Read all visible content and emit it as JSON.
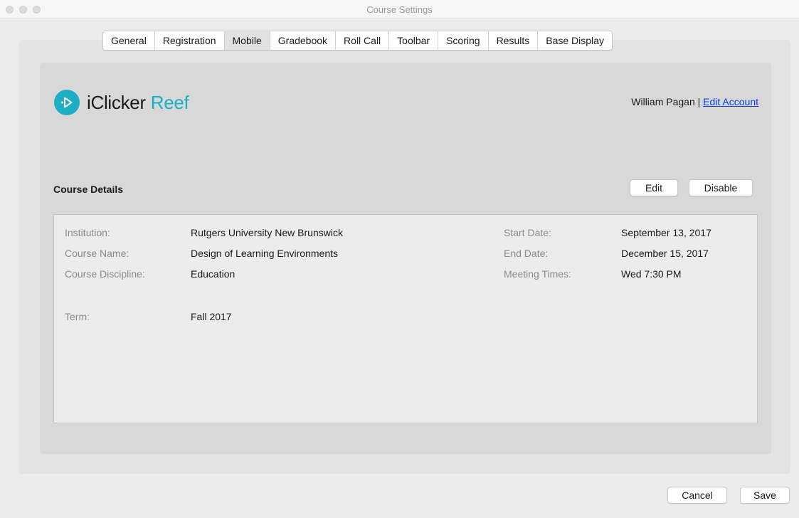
{
  "window": {
    "title": "Course Settings"
  },
  "tabs": [
    {
      "label": "General"
    },
    {
      "label": "Registration"
    },
    {
      "label": "Mobile"
    },
    {
      "label": "Gradebook"
    },
    {
      "label": "Roll Call"
    },
    {
      "label": "Toolbar"
    },
    {
      "label": "Scoring"
    },
    {
      "label": "Results"
    },
    {
      "label": "Base Display"
    }
  ],
  "active_tab": "Mobile",
  "brand": {
    "name": "iClicker",
    "product": "Reef",
    "accent": "#1eaec4",
    "icon": "play-arrow-icon"
  },
  "account": {
    "user": "William Pagan",
    "separator": "|",
    "edit_link": "Edit Account"
  },
  "course_details": {
    "title": "Course Details",
    "edit_label": "Edit",
    "disable_label": "Disable",
    "fields": {
      "institution": {
        "label": "Institution:",
        "value": "Rutgers University New Brunswick"
      },
      "course_name": {
        "label": "Course Name:",
        "value": "Design of Learning Environments"
      },
      "discipline": {
        "label": "Course Discipline:",
        "value": "Education"
      },
      "term": {
        "label": "Term:",
        "value": "Fall 2017"
      },
      "start_date": {
        "label": "Start Date:",
        "value": "September 13, 2017"
      },
      "end_date": {
        "label": "End Date:",
        "value": "December 15, 2017"
      },
      "meeting_times": {
        "label": "Meeting Times:",
        "value": "Wed 7:30 PM"
      }
    }
  },
  "footer": {
    "cancel_label": "Cancel",
    "save_label": "Save"
  }
}
